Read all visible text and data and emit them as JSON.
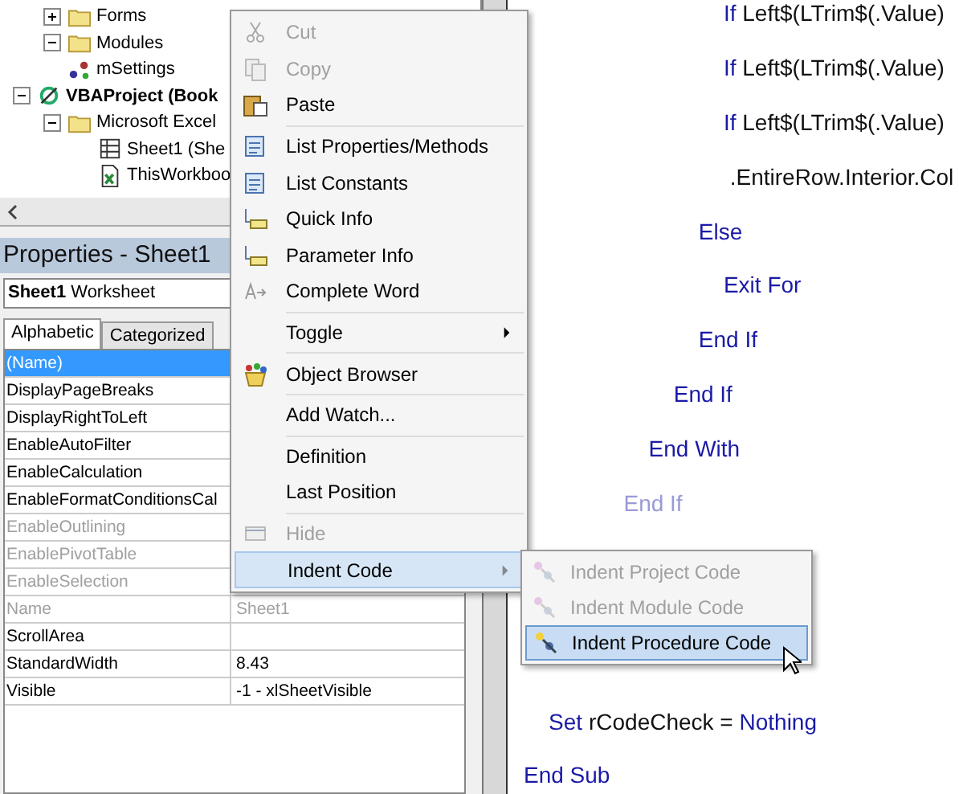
{
  "project_tree": {
    "items": [
      {
        "kind": "folder",
        "label": "Forms",
        "expanded": false,
        "bold": false
      },
      {
        "kind": "folder",
        "label": "Modules",
        "expanded": true,
        "bold": false,
        "children": [
          {
            "kind": "module",
            "label": "mSettings"
          }
        ]
      },
      {
        "kind": "project",
        "label": "VBAProject (Book",
        "expanded": true,
        "bold": true,
        "children": [
          {
            "kind": "folder",
            "label": "Microsoft Excel",
            "expanded": true,
            "children": [
              {
                "kind": "sheet",
                "label": "Sheet1 (She"
              },
              {
                "kind": "workbook",
                "label": "ThisWorkboo"
              }
            ]
          }
        ]
      }
    ]
  },
  "properties": {
    "title": "Properties - Sheet1",
    "object_name": "Sheet1",
    "object_type": "Worksheet",
    "tabs": [
      {
        "label": "Alphabetic",
        "selected": true
      },
      {
        "label": "Categorized",
        "selected": false
      }
    ],
    "rows": [
      {
        "name": "(Name)",
        "selected": true,
        "disabled": false
      },
      {
        "name": "DisplayPageBreaks",
        "selected": false,
        "disabled": false
      },
      {
        "name": "DisplayRightToLeft",
        "selected": false,
        "disabled": false
      },
      {
        "name": "EnableAutoFilter",
        "selected": false,
        "disabled": false
      },
      {
        "name": "EnableCalculation",
        "selected": false,
        "disabled": false
      },
      {
        "name": "EnableFormatConditionsCal",
        "selected": false,
        "disabled": false
      },
      {
        "name": "EnableOutlining",
        "selected": false,
        "disabled": true
      },
      {
        "name": "EnablePivotTable",
        "selected": false,
        "disabled": true
      },
      {
        "name": "EnableSelection",
        "selected": false,
        "disabled": true
      },
      {
        "name": "Name",
        "value": "Sheet1",
        "selected": false,
        "disabled": true
      },
      {
        "name": "ScrollArea",
        "selected": false,
        "disabled": false
      },
      {
        "name": "StandardWidth",
        "value": "8.43",
        "selected": false,
        "disabled": false
      },
      {
        "name": "Visible",
        "value": "-1 - xlSheetVisible",
        "selected": false,
        "disabled": false
      }
    ]
  },
  "code_lines": [
    {
      "kind": "code",
      "faded": false,
      "segments": [
        {
          "kind": "keyword",
          "text": "                                If "
        },
        {
          "kind": "plain",
          "text": "Left$(LTrim$(.Value)"
        }
      ]
    },
    {
      "kind": "code",
      "faded": false,
      "segments": [
        {
          "kind": "keyword",
          "text": "                                If "
        },
        {
          "kind": "plain",
          "text": "Left$(LTrim$(.Value)"
        }
      ]
    },
    {
      "kind": "code",
      "faded": false,
      "segments": [
        {
          "kind": "keyword",
          "text": "                                If "
        },
        {
          "kind": "plain",
          "text": "Left$(LTrim$(.Value)"
        }
      ]
    },
    {
      "kind": "code",
      "faded": false,
      "segments": [
        {
          "kind": "plain",
          "text": "                                 .EntireRow.Interior.Col"
        }
      ]
    },
    {
      "kind": "code",
      "faded": false,
      "segments": [
        {
          "kind": "keyword",
          "text": "                            Else"
        }
      ]
    },
    {
      "kind": "code",
      "faded": false,
      "segments": [
        {
          "kind": "keyword",
          "text": "                                Exit For"
        }
      ]
    },
    {
      "kind": "code",
      "faded": false,
      "segments": [
        {
          "kind": "keyword",
          "text": "                            End If"
        }
      ]
    },
    {
      "kind": "code",
      "faded": false,
      "segments": [
        {
          "kind": "keyword",
          "text": "                        End If"
        }
      ]
    },
    {
      "kind": "code",
      "faded": false,
      "segments": [
        {
          "kind": "keyword",
          "text": "                    End With"
        }
      ]
    },
    {
      "kind": "code",
      "faded": true,
      "segments": [
        {
          "kind": "keyword",
          "text": "                End If"
        }
      ]
    },
    {
      "kind": "covered"
    },
    {
      "kind": "covered"
    },
    {
      "kind": "covered"
    },
    {
      "kind": "code",
      "faded": false,
      "segments": [
        {
          "kind": "keyword",
          "text": "    Set "
        },
        {
          "kind": "plain",
          "text": "rCodeCheck = "
        },
        {
          "kind": "keyword",
          "text": "Nothing"
        }
      ]
    },
    {
      "kind": "code",
      "faded": false,
      "segments": [
        {
          "kind": "keyword",
          "text": "End Sub"
        }
      ]
    }
  ],
  "context_menu": {
    "items": [
      {
        "kind": "item",
        "label": "Cut",
        "disabled": true,
        "submenu": false,
        "selected": false
      },
      {
        "kind": "item",
        "label": "Copy",
        "disabled": true,
        "submenu": false,
        "selected": false
      },
      {
        "kind": "item",
        "label": "Paste",
        "disabled": false,
        "submenu": false,
        "selected": false
      },
      {
        "kind": "separator"
      },
      {
        "kind": "item",
        "label": "List Properties/Methods",
        "disabled": false,
        "submenu": false,
        "selected": false
      },
      {
        "kind": "item",
        "label": "List Constants",
        "disabled": false,
        "submenu": false,
        "selected": false
      },
      {
        "kind": "item",
        "label": "Quick Info",
        "disabled": false,
        "submenu": false,
        "selected": false
      },
      {
        "kind": "item",
        "label": "Parameter Info",
        "disabled": false,
        "submenu": false,
        "selected": false
      },
      {
        "kind": "item",
        "label": "Complete Word",
        "disabled": false,
        "submenu": false,
        "selected": false
      },
      {
        "kind": "separator"
      },
      {
        "kind": "item",
        "label": "Toggle",
        "disabled": false,
        "submenu": true,
        "selected": false
      },
      {
        "kind": "separator"
      },
      {
        "kind": "item",
        "label": "Object Browser",
        "disabled": false,
        "submenu": false,
        "selected": false
      },
      {
        "kind": "separator"
      },
      {
        "kind": "item",
        "label": "Add Watch...",
        "disabled": false,
        "submenu": false,
        "selected": false
      },
      {
        "kind": "separator"
      },
      {
        "kind": "item",
        "label": "Definition",
        "disabled": false,
        "submenu": false,
        "selected": false
      },
      {
        "kind": "item",
        "label": "Last Position",
        "disabled": false,
        "submenu": false,
        "selected": false
      },
      {
        "kind": "separator"
      },
      {
        "kind": "item",
        "label": "Hide",
        "disabled": true,
        "submenu": false,
        "selected": false
      },
      {
        "kind": "item",
        "label": "Indent Code",
        "disabled": false,
        "submenu": true,
        "selected": true
      }
    ]
  },
  "submenu": {
    "items": [
      {
        "label": "Indent Project Code",
        "disabled": true,
        "selected": false
      },
      {
        "label": "Indent Module Code",
        "disabled": true,
        "selected": false
      },
      {
        "label": "Indent Procedure Code",
        "disabled": false,
        "selected": true
      }
    ]
  }
}
